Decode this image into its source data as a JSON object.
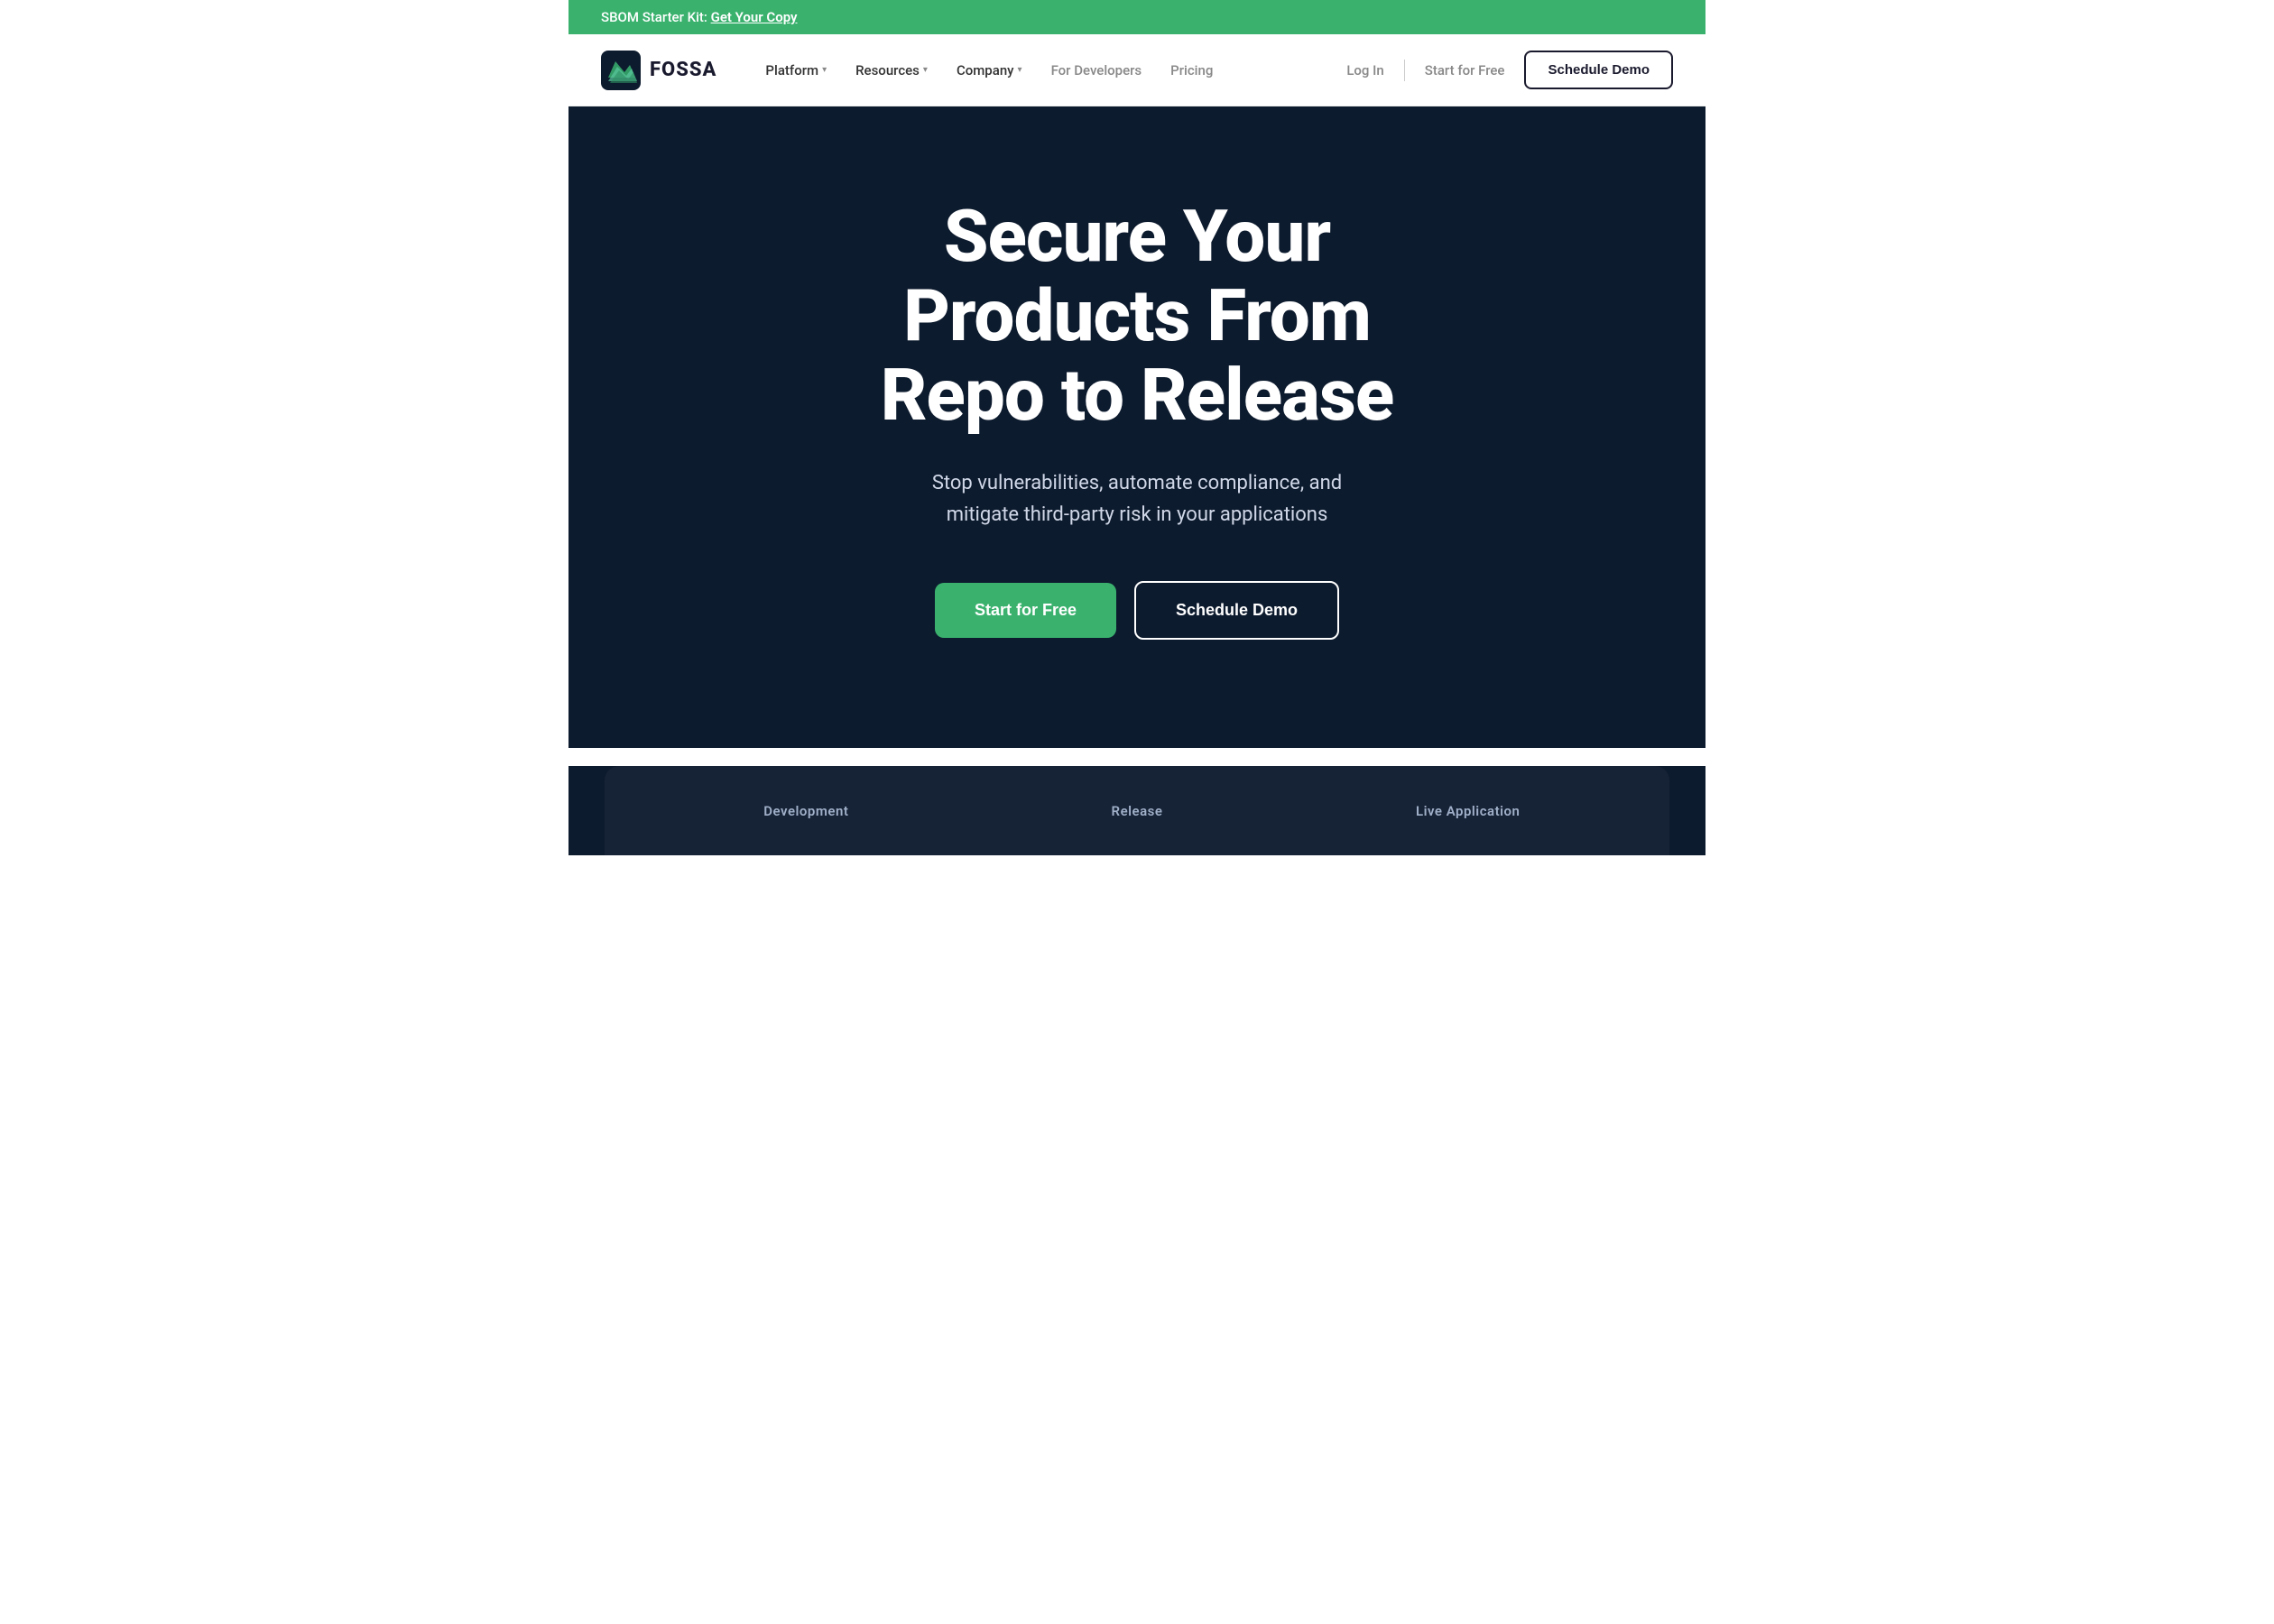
{
  "banner": {
    "text": "SBOM Starter Kit: ",
    "link_text": "Get Your Copy"
  },
  "nav": {
    "logo_text": "FOSSA",
    "items": [
      {
        "label": "Platform",
        "has_dropdown": true
      },
      {
        "label": "Resources",
        "has_dropdown": true
      },
      {
        "label": "Company",
        "has_dropdown": true
      },
      {
        "label": "For Developers",
        "has_dropdown": false
      },
      {
        "label": "Pricing",
        "has_dropdown": false
      }
    ],
    "login_label": "Log In",
    "start_free_label": "Start for Free",
    "schedule_demo_label": "Schedule Demo"
  },
  "hero": {
    "title": "Secure Your Products From Repo to Release",
    "subtitle": "Stop vulnerabilities, automate compliance, and mitigate third-party risk in your applications",
    "start_free_label": "Start for Free",
    "schedule_demo_label": "Schedule Demo"
  },
  "bottom_cards": {
    "cards": [
      {
        "label": "Development"
      },
      {
        "label": "Release"
      },
      {
        "label": "Live Application"
      }
    ]
  },
  "colors": {
    "banner_bg": "#3ab26e",
    "nav_bg": "#ffffff",
    "hero_bg": "#0d1b2e",
    "start_free_bg": "#3ab26e",
    "cards_bg": "#162236"
  }
}
